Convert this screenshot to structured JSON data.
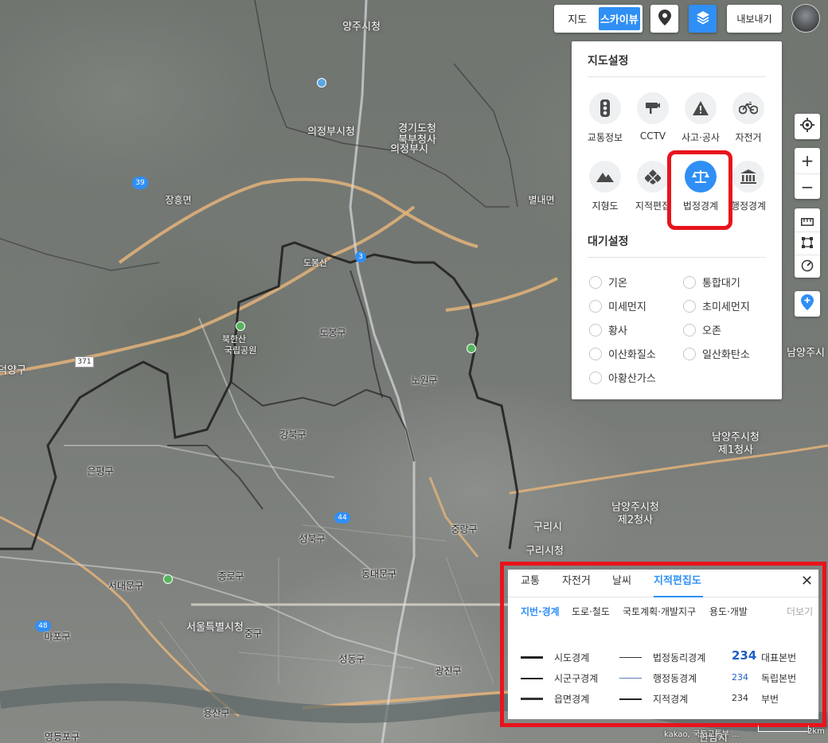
{
  "map": {
    "labels": [
      {
        "text": "양주시청",
        "kind": "city"
      },
      {
        "text": "의정부시",
        "kind": "city"
      },
      {
        "text": "의정부시청",
        "kind": "city"
      },
      {
        "text": "경기도청",
        "kind": "city"
      },
      {
        "text": "북부청사",
        "kind": "city"
      },
      {
        "text": "도봉산",
        "kind": "small"
      },
      {
        "text": "도봉구",
        "kind": "district"
      },
      {
        "text": "노원구",
        "kind": "district"
      },
      {
        "text": "강북구",
        "kind": "district"
      },
      {
        "text": "은평구",
        "kind": "district"
      },
      {
        "text": "성북구",
        "kind": "district"
      },
      {
        "text": "종로구",
        "kind": "district"
      },
      {
        "text": "동대문구",
        "kind": "district"
      },
      {
        "text": "중랑구",
        "kind": "district"
      },
      {
        "text": "서대문구",
        "kind": "district"
      },
      {
        "text": "마포구",
        "kind": "district"
      },
      {
        "text": "중구",
        "kind": "district"
      },
      {
        "text": "성동구",
        "kind": "district"
      },
      {
        "text": "광진구",
        "kind": "district"
      },
      {
        "text": "용산구",
        "kind": "district"
      },
      {
        "text": "영등포구",
        "kind": "district"
      },
      {
        "text": "서울특별시청",
        "kind": "city"
      },
      {
        "text": "구리시",
        "kind": "city"
      },
      {
        "text": "구리시청",
        "kind": "city"
      },
      {
        "text": "남양주시청",
        "kind": "city"
      },
      {
        "text": "제1청사",
        "kind": "city"
      },
      {
        "text": "남양주시청",
        "kind": "city"
      },
      {
        "text": "제2청사",
        "kind": "city"
      },
      {
        "text": "남양주시",
        "kind": "city"
      },
      {
        "text": "장흥면",
        "kind": "small"
      },
      {
        "text": "별내면",
        "kind": "small"
      },
      {
        "text": "북한산",
        "kind": "small"
      },
      {
        "text": "국립공원",
        "kind": "small"
      },
      {
        "text": "덕양구",
        "kind": "city"
      },
      {
        "text": "한남시",
        "kind": "city"
      }
    ],
    "highway_shield": "371",
    "route_shields": [
      "39",
      "3",
      "44",
      "48"
    ]
  },
  "topbar": {
    "map_type": [
      "지도",
      "스카이뷰"
    ],
    "map_type_active": "스카이뷰",
    "export_label": "내보내기"
  },
  "settings": {
    "map_title": "지도설정",
    "map_items": [
      {
        "label": "교통정보",
        "icon": "traffic-light-icon"
      },
      {
        "label": "CCTV",
        "icon": "cctv-icon"
      },
      {
        "label": "사고·공사",
        "icon": "warning-icon"
      },
      {
        "label": "자전거",
        "icon": "bicycle-icon"
      },
      {
        "label": "지형도",
        "icon": "mountain-icon"
      },
      {
        "label": "지적편집",
        "icon": "cadastral-icon"
      },
      {
        "label": "법정경계",
        "icon": "scale-icon",
        "active": true
      },
      {
        "label": "행정경계",
        "icon": "government-building-icon"
      }
    ],
    "air_title": "대기설정",
    "air_items": [
      "기온",
      "통합대기",
      "미세먼지",
      "초미세먼지",
      "황사",
      "오존",
      "이산화질소",
      "일산화탄소",
      "아황산가스"
    ]
  },
  "legend": {
    "tabs": [
      "교통",
      "자전거",
      "날씨",
      "지적편집도"
    ],
    "active_tab": "지적편집도",
    "subtabs": [
      "지번·경계",
      "도로·철도",
      "국토계획·개발지구",
      "용도·개발"
    ],
    "active_subtab": "지번·경계",
    "more_label": "더보기",
    "close_label": "✕",
    "col1": [
      "시도경계",
      "시군구경계",
      "읍면경계"
    ],
    "col2": [
      "법정동리경계",
      "행정동경계",
      "지적경계"
    ],
    "col3": [
      {
        "num": "234",
        "label": "대표본번"
      },
      {
        "num": "234",
        "label": "독립본번"
      },
      {
        "num": "234",
        "label": "부번"
      }
    ]
  },
  "footer": {
    "attribution": "kakao, 국토교통부 ...",
    "scale_label": "2km"
  },
  "colors": {
    "accent": "#2f8ff5",
    "highlight": "#e8141c"
  }
}
